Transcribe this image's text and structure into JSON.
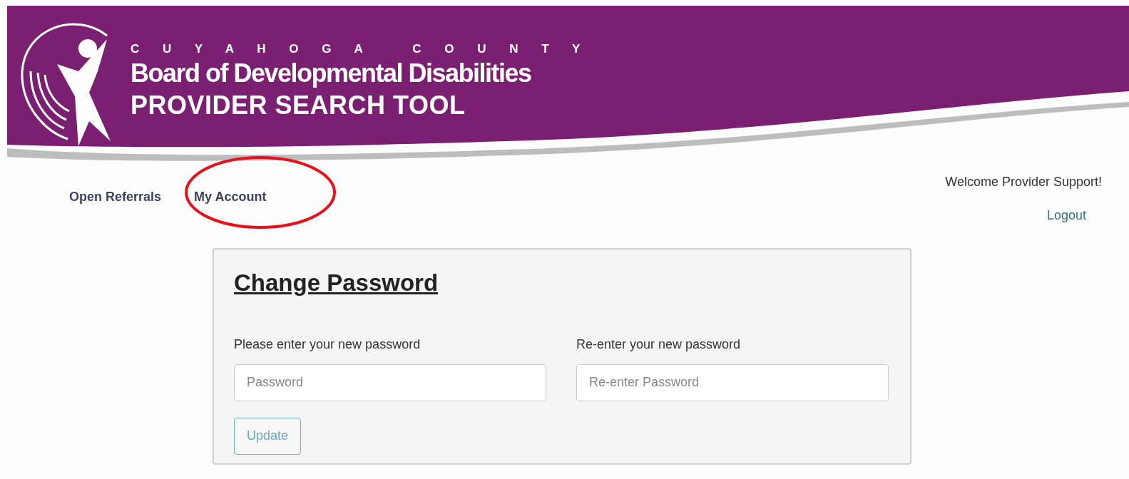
{
  "banner": {
    "county": "C U Y A H O G A   C O U N T Y",
    "board": "Board of Developmental Disabilities",
    "tool": "PROVIDER SEARCH TOOL"
  },
  "nav": [
    "Open Referrals",
    "My Account"
  ],
  "user": {
    "welcome": "Welcome Provider Support!",
    "logout": "Logout"
  },
  "card": {
    "title": "Change Password",
    "fields": [
      {
        "label": "Please enter your new password",
        "placeholder": "Password"
      },
      {
        "label": "Re-enter your new password",
        "placeholder": "Re-enter Password"
      }
    ],
    "button": "Update"
  }
}
